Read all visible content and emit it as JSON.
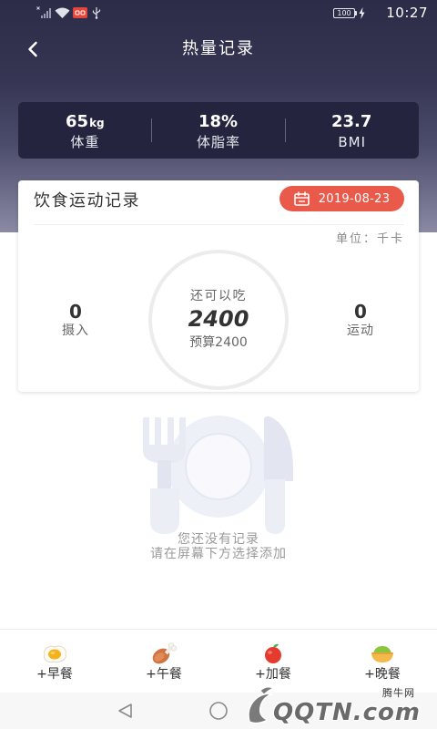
{
  "status_bar": {
    "time": "10:27",
    "battery_level": "100",
    "icons": [
      "no-sim-signal-icon",
      "wifi-icon",
      "app-notification-icon",
      "usb-icon",
      "battery-icon",
      "charging-icon"
    ]
  },
  "header": {
    "title": "热量记录",
    "back_icon": "back-arrow-icon"
  },
  "stats": [
    {
      "value": "65",
      "unit": "kg",
      "label": "体重"
    },
    {
      "value": "18%",
      "unit": "",
      "label": "体脂率"
    },
    {
      "value": "23.7",
      "unit": "",
      "label": "BMI"
    }
  ],
  "record_card": {
    "title": "饮食运动记录",
    "date": "2019-08-23",
    "date_icon": "calendar-icon",
    "unit_label": "单位：千卡",
    "intake": {
      "value": "0",
      "label": "摄入"
    },
    "exercise": {
      "value": "0",
      "label": "运动"
    },
    "remaining": {
      "caption": "还可以吃",
      "value": "2400",
      "budget": "预算2400"
    }
  },
  "empty_state": {
    "illustration": "plate-fork-knife-icon",
    "line1": "您还没有记录",
    "line2": "请在屏幕下方选择添加"
  },
  "meal_bar": [
    {
      "label": "+早餐",
      "icon": "fried-egg-icon"
    },
    {
      "label": "+午餐",
      "icon": "chicken-leg-icon"
    },
    {
      "label": "+加餐",
      "icon": "apple-icon"
    },
    {
      "label": "+晚餐",
      "icon": "rice-bowl-icon"
    }
  ],
  "nav_bar": {
    "icons": [
      "nav-back-icon",
      "nav-home-icon"
    ]
  },
  "watermark": {
    "brand_cn": "腾牛网",
    "brand_en": "QQTN.com"
  },
  "colors": {
    "header_top": "#2c2c48",
    "header_bottom": "#8a8aa5",
    "stats_card": "#24243e",
    "accent": "#ea5a4b",
    "ring": "#ececec",
    "illustration": "#eef0f7"
  }
}
